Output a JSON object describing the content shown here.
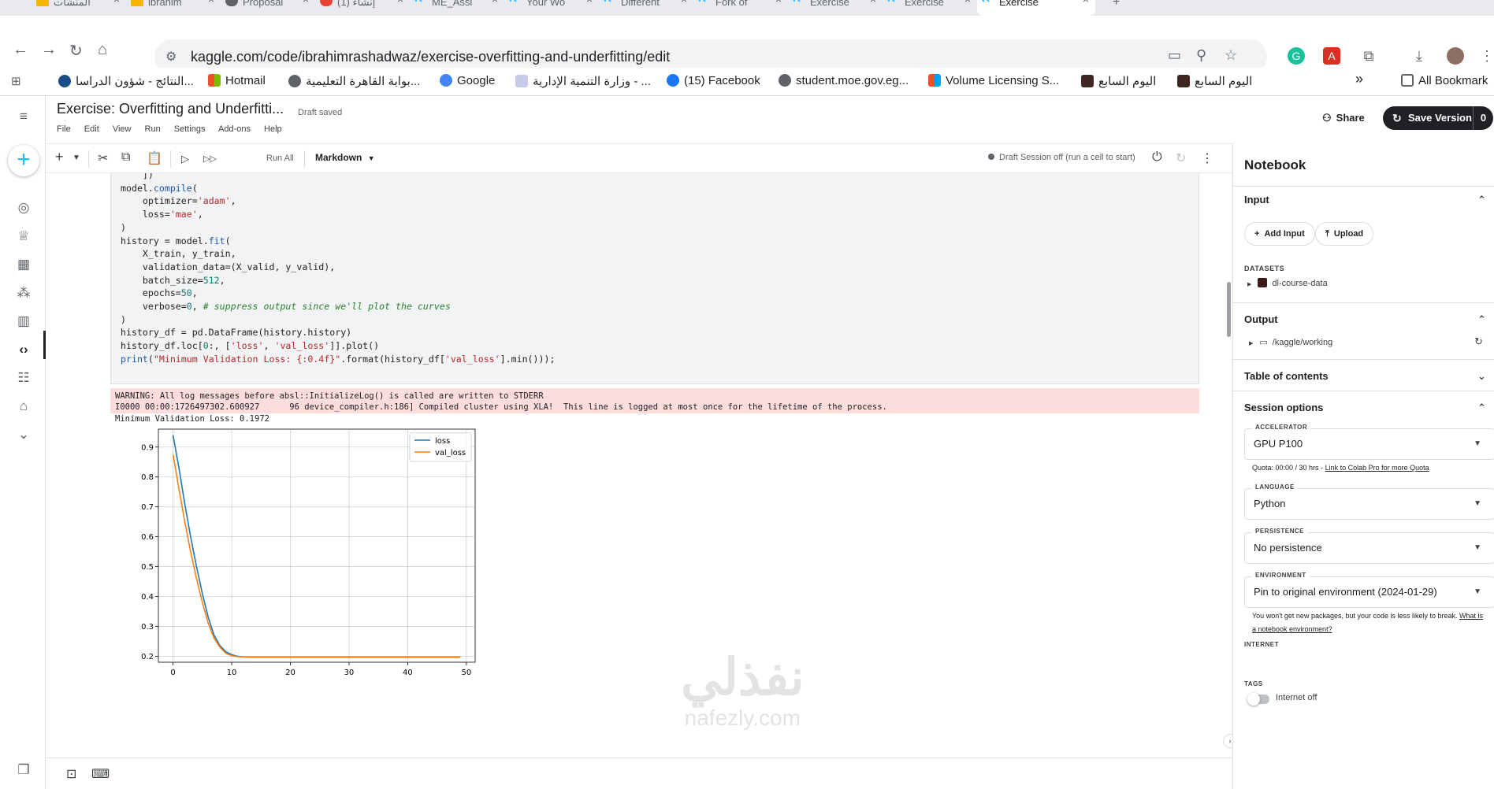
{
  "browser": {
    "tabs": [
      {
        "title": "المنشآت"
      },
      {
        "title": "ibrahim"
      },
      {
        "title": "Proposal"
      },
      {
        "title": "(1) إنشاء"
      },
      {
        "title": "ME_Assi"
      },
      {
        "title": "Your Wo"
      },
      {
        "title": "Different"
      },
      {
        "title": "Fork of"
      },
      {
        "title": "Exercise"
      },
      {
        "title": "Exercise"
      },
      {
        "title": "Exercise"
      }
    ],
    "url": "kaggle.com/code/ibrahimrashadwaz/exercise-overfitting-and-underfitting/edit",
    "bookmarks": [
      {
        "label": "النتائج - شؤون الدراسا..."
      },
      {
        "label": "Hotmail"
      },
      {
        "label": "بوابة القاهرة التعليمية..."
      },
      {
        "label": "Google"
      },
      {
        "label": "وزارة التنمية الإدارية - ..."
      },
      {
        "label": "(15) Facebook"
      },
      {
        "label": "student.moe.gov.eg..."
      },
      {
        "label": "Volume Licensing S..."
      },
      {
        "label": "اليوم السابع"
      },
      {
        "label": "اليوم السابع"
      }
    ],
    "all_bookmarks": "All Bookmark",
    "more_glyph": "»"
  },
  "header": {
    "title": "Exercise: Overfitting and Underfitti...",
    "draft_status": "Draft saved",
    "menu": [
      "File",
      "Edit",
      "View",
      "Run",
      "Settings",
      "Add-ons",
      "Help"
    ],
    "share_label": "Share",
    "save_label": "Save Version",
    "save_count": "0"
  },
  "toolbar": {
    "run_all": "Run All",
    "cell_type": "Markdown",
    "session": "Draft Session off (run a cell to start)"
  },
  "output": {
    "stderr_lines": [
      "WARNING: All log messages before absl::InitializeLog() is called are written to STDERR",
      "I0000 00:00:1726497302.600927      96 device_compiler.h:186] Compiled cluster using XLA!  This line is logged at most once for the lifetime of the process."
    ],
    "stdout": "Minimum Validation Loss: 0.1972"
  },
  "chart_data": {
    "type": "line",
    "xlim": [
      -2.5,
      51.5
    ],
    "ylim": [
      0.18,
      0.96
    ],
    "x_ticks": [
      0,
      10,
      20,
      30,
      40,
      50
    ],
    "y_ticks": [
      0.2,
      0.3,
      0.4,
      0.5,
      0.6,
      0.7,
      0.8,
      0.9
    ],
    "grid": true,
    "legend": "top-right",
    "series": [
      {
        "name": "loss",
        "color": "#1f77b4",
        "x": [
          0,
          1,
          2,
          3,
          4,
          5,
          6,
          7,
          8,
          9,
          10,
          11,
          12,
          13,
          14,
          15,
          20,
          30,
          40,
          49
        ],
        "y": [
          0.94,
          0.83,
          0.71,
          0.6,
          0.5,
          0.41,
          0.33,
          0.27,
          0.235,
          0.215,
          0.205,
          0.2,
          0.198,
          0.197,
          0.197,
          0.197,
          0.197,
          0.197,
          0.197,
          0.197
        ]
      },
      {
        "name": "val_loss",
        "color": "#ff7f0e",
        "x": [
          0,
          1,
          2,
          3,
          4,
          5,
          6,
          7,
          8,
          9,
          10,
          11,
          12,
          13,
          14,
          15,
          20,
          30,
          40,
          49
        ],
        "y": [
          0.875,
          0.76,
          0.65,
          0.55,
          0.46,
          0.38,
          0.31,
          0.26,
          0.23,
          0.21,
          0.202,
          0.199,
          0.198,
          0.197,
          0.197,
          0.197,
          0.197,
          0.197,
          0.197,
          0.197
        ]
      }
    ]
  },
  "watermark": {
    "arabic": "نفذلي",
    "latin": "nafezly.com"
  },
  "panel": {
    "title": "Notebook",
    "input": {
      "heading": "Input",
      "add_input": "Add Input",
      "upload": "Upload",
      "datasets_label": "DATASETS",
      "dataset": "dl-course-data"
    },
    "output": {
      "heading": "Output",
      "path": "/kaggle/working"
    },
    "toc": {
      "heading": "Table of contents"
    },
    "session": {
      "heading": "Session options",
      "accelerator_label": "ACCELERATOR",
      "accelerator": "GPU P100",
      "quota": "Quota: 00:00 / 30 hrs - ",
      "quota_link": "Link to Colab Pro for more Quota",
      "language_label": "LANGUAGE",
      "language": "Python",
      "persistence_label": "PERSISTENCE",
      "persistence": "No persistence",
      "environment_label": "ENVIRONMENT",
      "environment": "Pin to original environment (2024-01-29)",
      "env_note": "You won't get new packages, but your code is less likely to break. ",
      "env_link": "What is a notebook environment?",
      "internet_label": "INTERNET",
      "internet": "Internet off",
      "tags_label": "TAGS"
    }
  }
}
